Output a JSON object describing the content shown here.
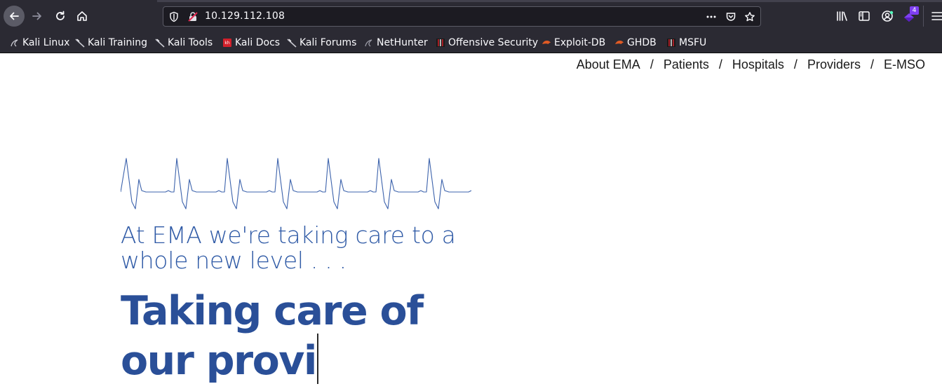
{
  "browser": {
    "url": "10.129.112.108",
    "extension_badge": "4",
    "bookmarks": [
      {
        "label": "Kali Linux",
        "icon": "kali-dragon-icon"
      },
      {
        "label": "Kali Training",
        "icon": "kali-dragon-icon"
      },
      {
        "label": "Kali Tools",
        "icon": "kali-dragon-icon"
      },
      {
        "label": "Kali Docs",
        "icon": "kali-docs-icon"
      },
      {
        "label": "Kali Forums",
        "icon": "kali-dragon-icon"
      },
      {
        "label": "NetHunter",
        "icon": "kali-dragon-icon"
      },
      {
        "label": "Offensive Security",
        "icon": "offsec-icon"
      },
      {
        "label": "Exploit-DB",
        "icon": "exploit-db-icon"
      },
      {
        "label": "GHDB",
        "icon": "exploit-db-icon"
      },
      {
        "label": "MSFU",
        "icon": "offsec-icon"
      }
    ]
  },
  "site": {
    "nav": {
      "items": [
        "About EMA",
        "Patients",
        "Hospitals",
        "Providers",
        "E-MSO"
      ],
      "separator": "/"
    },
    "tagline": "At EMA we're taking care to a whole new level . . .",
    "headline_line1": "Taking care of",
    "headline_line2": "our provi"
  },
  "colors": {
    "chrome": "#2b2a33",
    "url_field": "#1c1b22",
    "brand_blue": "#2f5aa6",
    "headline_blue": "#2a4f98"
  }
}
